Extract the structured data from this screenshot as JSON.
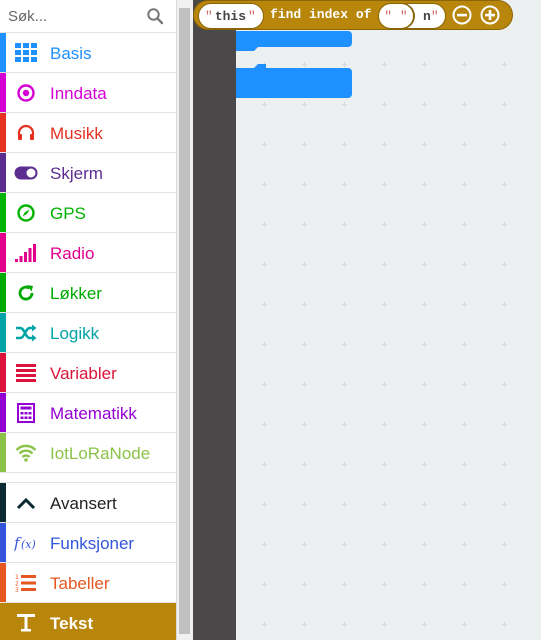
{
  "search": {
    "placeholder": "Søk..."
  },
  "categories": [
    {
      "label": "Basis",
      "color": "#1e90ff",
      "icon": "grid-icon"
    },
    {
      "label": "Inndata",
      "color": "#d400d4",
      "icon": "target-icon"
    },
    {
      "label": "Musikk",
      "color": "#e63022",
      "icon": "headphones-icon"
    },
    {
      "label": "Skjerm",
      "color": "#5c2d91",
      "icon": "toggle-icon"
    },
    {
      "label": "GPS",
      "color": "#00b300",
      "icon": "compass-icon"
    },
    {
      "label": "Radio",
      "color": "#e3008c",
      "icon": "signal-bars-icon"
    },
    {
      "label": "Løkker",
      "color": "#00aa00",
      "icon": "refresh-icon"
    },
    {
      "label": "Logikk",
      "color": "#00a4a6",
      "icon": "shuffle-icon"
    },
    {
      "label": "Variabler",
      "color": "#dc143c",
      "icon": "lines-icon"
    },
    {
      "label": "Matematikk",
      "color": "#9400d3",
      "icon": "calculator-icon"
    },
    {
      "label": "IotLoRaNode",
      "color": "#8bc34a",
      "icon": "wifi-icon"
    }
  ],
  "advanced": [
    {
      "label": "Avansert",
      "color": "#0b2a32",
      "icon": "chevron-up-icon"
    },
    {
      "label": "Funksjoner",
      "color": "#3455db",
      "icon": "function-icon"
    },
    {
      "label": "Tabeller",
      "color": "#e65722",
      "icon": "numbered-list-icon"
    },
    {
      "label": "Tekst",
      "color": "#b8860b",
      "icon": "text-t-icon",
      "selected": true
    }
  ],
  "block": {
    "text_value": "this",
    "find_label": "find index of",
    "search_value": " ",
    "trailing_text": "n",
    "color": "#b8860b"
  }
}
